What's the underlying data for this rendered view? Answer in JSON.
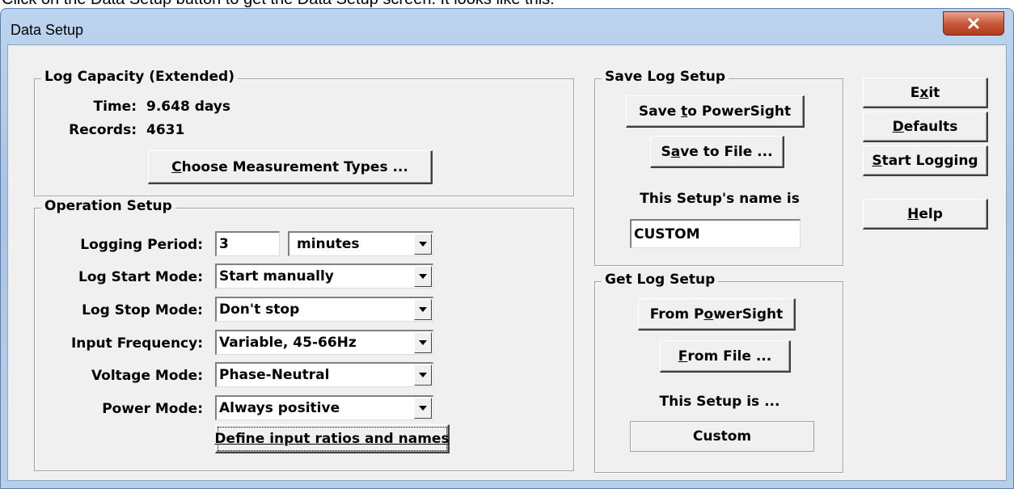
{
  "caption_text": "Click on the Data Setup button to get the Data Setup screen. It looks like this:",
  "window": {
    "title": "Data Setup"
  },
  "log_capacity": {
    "legend": "Log Capacity (Extended)",
    "time_label": "Time:",
    "time_value": "9.648 days",
    "records_label": "Records:",
    "records_value": "4631",
    "choose_button": {
      "pre": "",
      "accel": "C",
      "post": "hoose Measurement Types ..."
    }
  },
  "operation_setup": {
    "legend": "Operation Setup",
    "logging_period_label": "Logging Period:",
    "logging_period_value": "3",
    "logging_period_unit": "minutes",
    "log_start_label": "Log Start Mode:",
    "log_start_value": "Start manually",
    "log_stop_label": "Log Stop Mode:",
    "log_stop_value": "Don't stop",
    "input_freq_label": "Input Frequency:",
    "input_freq_value": "Variable, 45-66Hz",
    "voltage_label": "Voltage Mode:",
    "voltage_value": "Phase-Neutral",
    "power_label": "Power Mode:",
    "power_value": "Always positive",
    "define_button": "Define input ratios and names"
  },
  "save_log_setup": {
    "legend": "Save Log Setup",
    "save_powersight": {
      "pre": "Save ",
      "accel": "t",
      "post": "o PowerSight"
    },
    "save_file": {
      "pre": "S",
      "accel": "a",
      "post": "ve to File ..."
    },
    "name_label": "This Setup's name is",
    "name_value": "CUSTOM"
  },
  "get_log_setup": {
    "legend": "Get Log Setup",
    "from_powersight": {
      "pre": "From P",
      "accel": "o",
      "post": "werSight"
    },
    "from_file": {
      "pre": "",
      "accel": "F",
      "post": "rom File ..."
    },
    "setup_label": "This Setup is ...",
    "setup_value": "Custom"
  },
  "side_buttons": {
    "exit": {
      "pre": "E",
      "accel": "x",
      "post": "it"
    },
    "defaults": {
      "pre": "",
      "accel": "D",
      "post": "efaults"
    },
    "start_logging": {
      "pre": "",
      "accel": "S",
      "post": "tart Logging"
    },
    "help": {
      "pre": "",
      "accel": "H",
      "post": "elp"
    }
  },
  "icons": {
    "close": "close-icon",
    "dropdown": "chevron-down-icon"
  },
  "colors": {
    "close_button": "#c75a3c",
    "title_bar": "#b9d1ea",
    "dialog_face": "#f0f0f0"
  }
}
